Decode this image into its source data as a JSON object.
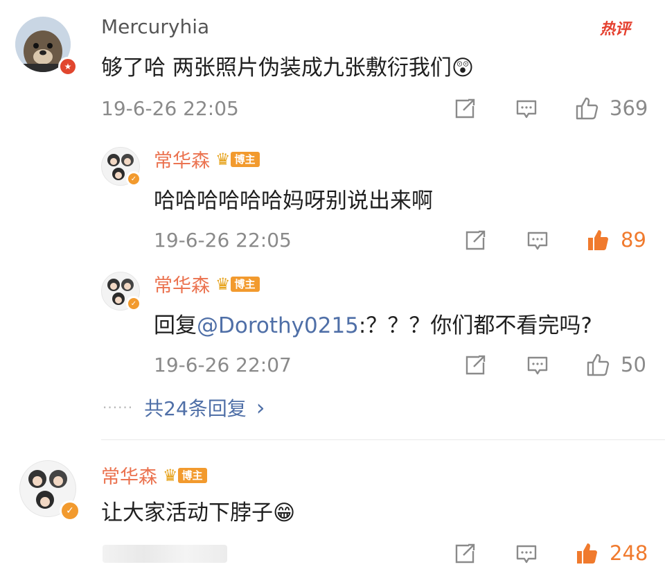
{
  "colors": {
    "accent": "#eb7350",
    "link": "#4f6fa7",
    "like_active": "#f07a2d",
    "muted": "#8a8a8a"
  },
  "hot_label": "热评",
  "comment1": {
    "username": "Mercuryhia",
    "text": "够了哈 两张照片伪装成九张敷衍我们",
    "emoji": "😲",
    "timestamp": "19-6-26 22:05",
    "likes": "369"
  },
  "reply1": {
    "username": "常华森",
    "badge": "博主",
    "text": "哈哈哈哈哈哈妈呀别说出来啊",
    "timestamp": "19-6-26 22:05",
    "likes": "89"
  },
  "reply2": {
    "username": "常华森",
    "badge": "博主",
    "text_prefix": "回复",
    "mention": "@Dorothy0215",
    "text_suffix": ":？？？你们都不看完吗?",
    "timestamp": "19-6-26 22:07",
    "likes": "50"
  },
  "more_replies": {
    "dots": "······",
    "label": "共24条回复",
    "arrow": "›"
  },
  "comment2": {
    "username": "常华森",
    "badge": "博主",
    "text": "让大家活动下脖子",
    "emoji": "😁",
    "likes": "248"
  }
}
